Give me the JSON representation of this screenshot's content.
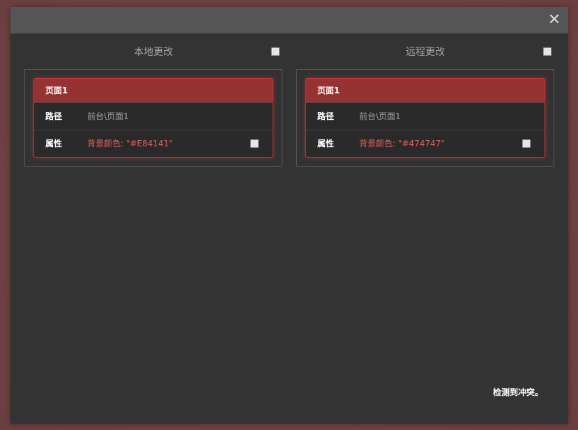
{
  "dialog": {
    "close_icon": "close-icon",
    "close_glyph": "✕"
  },
  "local": {
    "title": "本地更改",
    "card": {
      "header": "页面1",
      "path_label": "路径",
      "path_value": "前台\\页面1",
      "prop_label": "属性",
      "prop_value": "背景颜色: \"#E84141\""
    }
  },
  "remote": {
    "title": "远程更改",
    "card": {
      "header": "页面1",
      "path_label": "路径",
      "path_value": "前台\\页面1",
      "prop_label": "属性",
      "prop_value": "背景颜色: \"#474747\""
    }
  },
  "status": "检测到冲突。",
  "colors": {
    "accent": "#953232",
    "changed_text": "#e06060"
  }
}
